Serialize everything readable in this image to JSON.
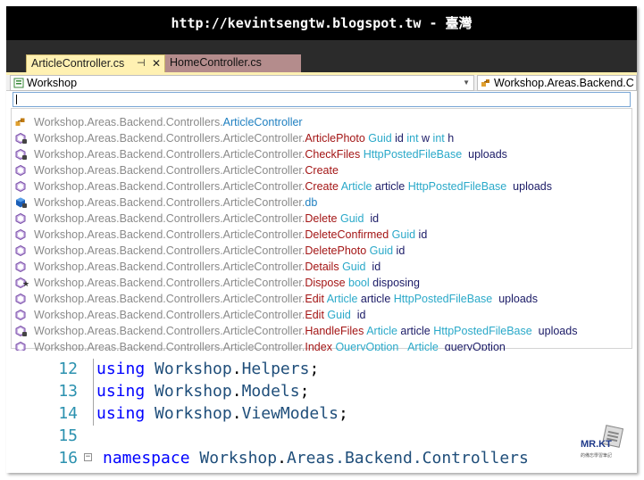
{
  "banner": {
    "text": "http://kevintsengtw.blogspot.tw - 臺灣"
  },
  "tabs": [
    {
      "label": "ArticleController.cs",
      "pin": "⊣",
      "close": "✕",
      "active": true
    },
    {
      "label": "HomeController.cs",
      "active": false
    }
  ],
  "navbar": {
    "left": {
      "value": "Workshop",
      "icon": "project-icon"
    },
    "right": {
      "value": "Workshop.Areas.Backend.C",
      "icon": "class-icon"
    }
  },
  "search": {
    "value": ""
  },
  "intellisense": {
    "items": [
      {
        "icon": "class-icon",
        "access": "",
        "ns": "Workshop.Areas.Backend.Controllers.",
        "name": "ArticleController",
        "name_style": "blue",
        "params": []
      },
      {
        "icon": "method-icon",
        "access": "private",
        "ns": "Workshop.Areas.Backend.Controllers.ArticleController.",
        "name": "ArticlePhoto",
        "params": [
          [
            "Guid",
            " id"
          ],
          [
            "int",
            " w"
          ],
          [
            "int",
            " h"
          ]
        ]
      },
      {
        "icon": "method-icon",
        "access": "private",
        "ns": "Workshop.Areas.Backend.Controllers.ArticleController.",
        "name": "CheckFiles",
        "params": [
          [
            "HttpPostedFileBase",
            "  uploads"
          ]
        ]
      },
      {
        "icon": "method-icon",
        "access": "",
        "ns": "Workshop.Areas.Backend.Controllers.ArticleController.",
        "name": "Create",
        "params": []
      },
      {
        "icon": "method-icon",
        "access": "",
        "ns": "Workshop.Areas.Backend.Controllers.ArticleController.",
        "name": "Create",
        "params": [
          [
            "Article",
            " article"
          ],
          [
            "HttpPostedFileBase",
            "  uploads"
          ]
        ]
      },
      {
        "icon": "field-icon",
        "access": "private",
        "ns": "Workshop.Areas.Backend.Controllers.ArticleController.",
        "name": "db",
        "name_style": "blue",
        "params": []
      },
      {
        "icon": "method-icon",
        "access": "",
        "ns": "Workshop.Areas.Backend.Controllers.ArticleController.",
        "name": "Delete",
        "params": [
          [
            "Guid",
            "  id"
          ]
        ]
      },
      {
        "icon": "method-icon",
        "access": "",
        "ns": "Workshop.Areas.Backend.Controllers.ArticleController.",
        "name": "DeleteConfirmed",
        "params": [
          [
            "Guid",
            " id"
          ]
        ]
      },
      {
        "icon": "method-icon",
        "access": "",
        "ns": "Workshop.Areas.Backend.Controllers.ArticleController.",
        "name": "DeletePhoto",
        "params": [
          [
            "Guid",
            " id"
          ]
        ]
      },
      {
        "icon": "method-icon",
        "access": "",
        "ns": "Workshop.Areas.Backend.Controllers.ArticleController.",
        "name": "Details",
        "params": [
          [
            "Guid",
            "  id"
          ]
        ]
      },
      {
        "icon": "method-icon",
        "access": "protected",
        "ns": "Workshop.Areas.Backend.Controllers.ArticleController.",
        "name": "Dispose",
        "params": [
          [
            "bool",
            " disposing"
          ]
        ]
      },
      {
        "icon": "method-icon",
        "access": "",
        "ns": "Workshop.Areas.Backend.Controllers.ArticleController.",
        "name": "Edit",
        "params": [
          [
            "Article",
            " article"
          ],
          [
            "HttpPostedFileBase",
            "  uploads"
          ]
        ]
      },
      {
        "icon": "method-icon",
        "access": "",
        "ns": "Workshop.Areas.Backend.Controllers.ArticleController.",
        "name": "Edit",
        "params": [
          [
            "Guid",
            "  id"
          ]
        ]
      },
      {
        "icon": "method-icon",
        "access": "private",
        "ns": "Workshop.Areas.Backend.Controllers.ArticleController.",
        "name": "HandleFiles",
        "params": [
          [
            "Article",
            " article"
          ],
          [
            "HttpPostedFileBase",
            "  uploads"
          ]
        ]
      },
      {
        "icon": "method-icon",
        "access": "",
        "ns": "Workshop.Areas.Backend.Controllers.ArticleController.",
        "name": "Index",
        "params": [
          [
            "QueryOption",
            "  "
          ],
          [
            "Article",
            "  queryOption"
          ]
        ]
      }
    ]
  },
  "code": {
    "lines": [
      {
        "num": "12",
        "kw": "using",
        "ns1": "Workshop",
        "dot": ".",
        "ns2": "Helpers",
        "end": ";"
      },
      {
        "num": "13",
        "kw": "using",
        "ns1": "Workshop",
        "dot": ".",
        "ns2": "Models",
        "end": ";"
      },
      {
        "num": "14",
        "kw": "using",
        "ns1": "Workshop",
        "dot": ".",
        "ns2": "ViewModels",
        "end": ";"
      },
      {
        "num": "15",
        "kw": "",
        "ns1": "",
        "dot": "",
        "ns2": "",
        "end": ""
      },
      {
        "num": "16",
        "kw": "namespace",
        "ns1": "Workshop",
        "dot": ".",
        "ns2": "Areas.Backend.Controllers",
        "end": ""
      }
    ]
  },
  "logo": {
    "title": "MR.KT",
    "subtitle": "的備忘學習筆記"
  },
  "colors": {
    "active_tab": "#fff1b2",
    "inactive_tab": "#b48c8c",
    "method_name": "#a31515",
    "param_type": "#2aa9c9",
    "keyword": "#0000ff",
    "line_number": "#2b91af"
  }
}
